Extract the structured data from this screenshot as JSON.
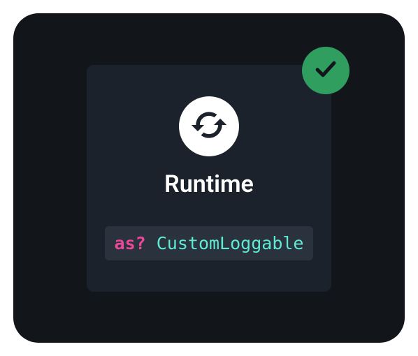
{
  "card": {
    "title": "Runtime",
    "icon_name": "sync-icon",
    "badge_icon_name": "checkmark-icon",
    "code": {
      "keyword": "as?",
      "type": "CustomLoggable"
    }
  },
  "colors": {
    "outer_bg": "#12161b",
    "inner_bg": "#1b222b",
    "badge_bg": "#2f9e5f",
    "code_bg": "#2a323d",
    "keyword": "#ec4899",
    "type": "#5eead4"
  }
}
